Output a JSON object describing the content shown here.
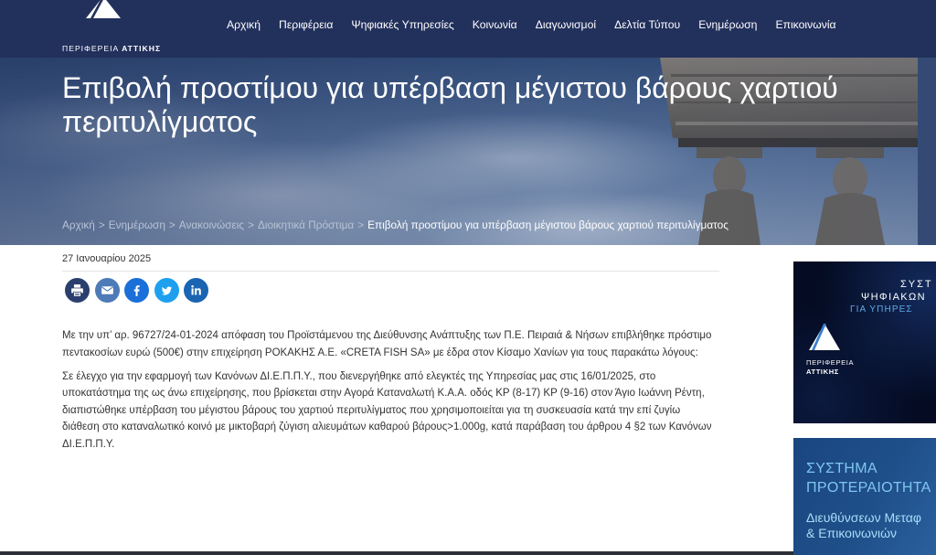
{
  "colors": {
    "header_bg": "#22305c",
    "body_text": "#333333",
    "breadcrumb_link": "#b8c3d6",
    "banner1_bg": "#040b22",
    "banner2_bg": "#1f4f89",
    "accent_light_blue": "#7fc6f0"
  },
  "header": {
    "logo": {
      "word1": "ΠΕΡΙΦΕΡΕΙΑ",
      "word2": "ΑΤΤΙΚΗΣ",
      "icon": "attica-logo-icon"
    },
    "nav": [
      "Αρχική",
      "Περιφέρεια",
      "Ψηφιακές Υπηρεσίες",
      "Κοινωνία",
      "Διαγωνισμοί",
      "Δελτία Τύπου",
      "Ενημέρωση",
      "Επικοινωνία"
    ]
  },
  "hero": {
    "title": "Επιβολή προστίμου για υπέρβαση μέγιστου βάρους χαρτιού περιτυλίγματος",
    "breadcrumb_separator": ">",
    "breadcrumb": [
      "Αρχική",
      "Ενημέρωση",
      "Ανακοινώσεις",
      "Διοικητικά Πρόστιμα",
      "Επιβολή προστίμου για υπέρβαση μέγιστου βάρους χαρτιού περιτυλίγματος"
    ]
  },
  "article": {
    "date": "27 Ιανουαρίου 2025",
    "share": [
      {
        "icon": "print-icon",
        "color": "#2b3f6e"
      },
      {
        "icon": "email-icon",
        "color": "#4d7bb8"
      },
      {
        "icon": "facebook-icon",
        "color": "#1b6fd8"
      },
      {
        "icon": "twitter-icon",
        "color": "#1ea0ef"
      },
      {
        "icon": "linkedin-icon",
        "color": "#1a64b2"
      }
    ],
    "paragraphs": [
      "Με την υπ’ αρ. 96727/24-01-2024 απόφαση του Προϊστάμενου της Διεύθυνσης Ανάπτυξης των Π.Ε. Πειραιά & Νήσων επιβλήθηκε πρόστιμο πεντακοσίων ευρώ (500€) στην επιχείρηση ΡΟΚΑΚΗΣ Α.Ε. «CRETA FISH SA» με έδρα στον Κίσαμο Χανίων για τους παρακάτω λόγους:",
      "Σε έλεγχο για την εφαρμογή των Κανόνων ΔΙ.Ε.Π.Π.Υ., που διενεργήθηκε από ελεγκτές της Υπηρεσίας μας στις 16/01/2025, στο υποκατάστημα της ως άνω επιχείρησης, που βρίσκεται στην Αγορά Καταναλωτή Κ.Α.Α. οδός ΚΡ (8-17) ΚΡ (9-16) στον Άγιο Ιωάννη Ρέντη, διαπιστώθηκε υπέρβαση του μέγιστου βάρους του χαρτιού περιτυλίγματος που χρησιμοποιείται για τη συσκευασία κατά την επί ζυγίω διάθεση στο καταναλωτικό κοινό με μικτοβαρή ζύγιση αλιευμάτων καθαρού βάρους>1.000g, κατά παράβαση του άρθρου 4 §2 των Κανόνων ΔΙ.Ε.Π.Π.Υ."
    ]
  },
  "sidebar": {
    "banner1": {
      "lines": [
        "ΣΥΣΤ",
        "ΨΗΦΙΑΚΩΝ",
        "ΓΙΑ ΥΠΗΡΕΣ"
      ],
      "logo_word1": "ΠΕΡΙΦΕΡΕΙΑ",
      "logo_word2": "ΑΤΤΙΚΗΣ"
    },
    "banner2": {
      "title_lines": [
        "ΣΥΣΤΗΜΑ",
        "ΠΡΟΤΕΡΑΙΟΤΗΤΑ"
      ],
      "subtitle_lines": [
        "Διευθύνσεων Μεταφ",
        "& Επικοινωνιών"
      ]
    }
  }
}
